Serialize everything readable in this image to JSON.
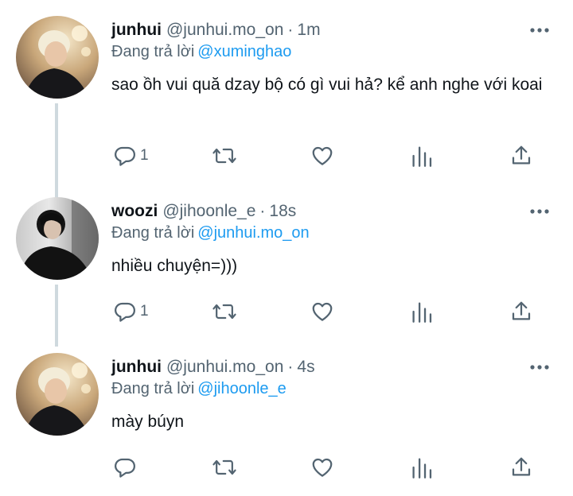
{
  "tweets": [
    {
      "name": "junhui",
      "handle": "@junhui.mo_on",
      "separator": "·",
      "time": "1m",
      "replying_prefix": "Đang trả lời",
      "replying_to": "@xuminghao",
      "text": "sao ồh vui quă dzay bộ có gì vui hả? kể anh nghe với koai",
      "reply_count": "1",
      "avatar_style": "blonde-portrait"
    },
    {
      "name": "woozi",
      "handle": "@jihoonle_e",
      "separator": "·",
      "time": "18s",
      "replying_prefix": "Đang trả lời",
      "replying_to": "@junhui.mo_on",
      "text": "nhiều chuyện=)))",
      "reply_count": "1",
      "avatar_style": "dark-hair-portrait"
    },
    {
      "name": "junhui",
      "handle": "@junhui.mo_on",
      "separator": "·",
      "time": "4s",
      "replying_prefix": "Đang trả lời",
      "replying_to": "@jihoonle_e",
      "text": "mày búyn",
      "reply_count": "",
      "avatar_style": "blonde-portrait"
    }
  ],
  "colors": {
    "link": "#1d9bf0",
    "secondary": "#536471",
    "thread_line": "#cfd9de"
  },
  "icons": [
    "more-icon",
    "reply-icon",
    "retweet-icon",
    "like-icon",
    "analytics-icon",
    "share-icon"
  ]
}
